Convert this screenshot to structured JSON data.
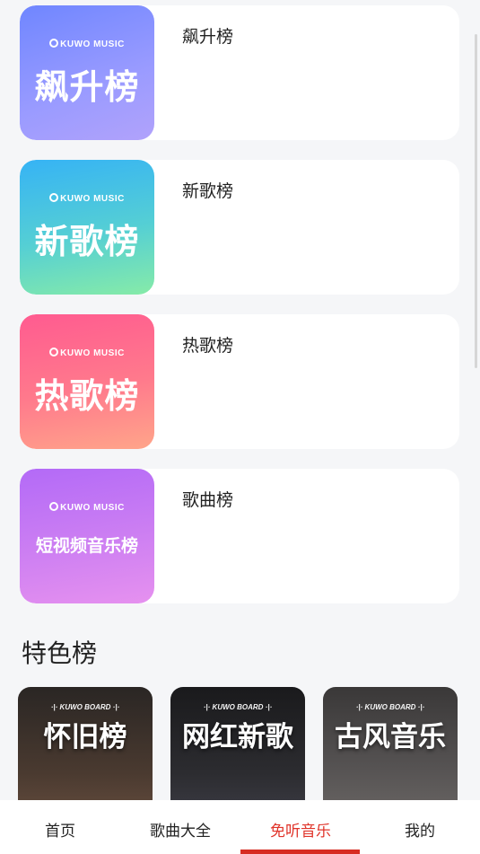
{
  "charts": [
    {
      "name": "飙升榜",
      "cover_brand": "KUWO MUSIC",
      "cover_title": "飙升榜"
    },
    {
      "name": "新歌榜",
      "cover_brand": "KUWO MUSIC",
      "cover_title": "新歌榜"
    },
    {
      "name": "热歌榜",
      "cover_brand": "KUWO MUSIC",
      "cover_title": "热歌榜"
    },
    {
      "name": "歌曲榜",
      "cover_brand": "KUWO MUSIC",
      "cover_title": "短视频音乐榜"
    }
  ],
  "featured": {
    "title": "特色榜",
    "items": [
      {
        "brand": "·|· KUWO BOARD ·|·",
        "title": "怀旧榜"
      },
      {
        "brand": "·|· KUWO BOARD ·|·",
        "title": "网红新歌"
      },
      {
        "brand": "·|· KUWO BOARD ·|·",
        "title": "古风音乐"
      }
    ]
  },
  "tabs": [
    {
      "label": "首页"
    },
    {
      "label": "歌曲大全"
    },
    {
      "label": "免听音乐"
    },
    {
      "label": "我的"
    }
  ],
  "active_tab": "免听音乐",
  "colors": {
    "accent": "#d72c22",
    "cover_1": [
      "#6f86ff",
      "#a79df9"
    ],
    "cover_2": [
      "#3cb7f2",
      "#7ee8b0"
    ],
    "cover_3": [
      "#ff5f8f",
      "#ffa08a"
    ],
    "cover_4": [
      "#b66cf6",
      "#e890f0"
    ]
  }
}
